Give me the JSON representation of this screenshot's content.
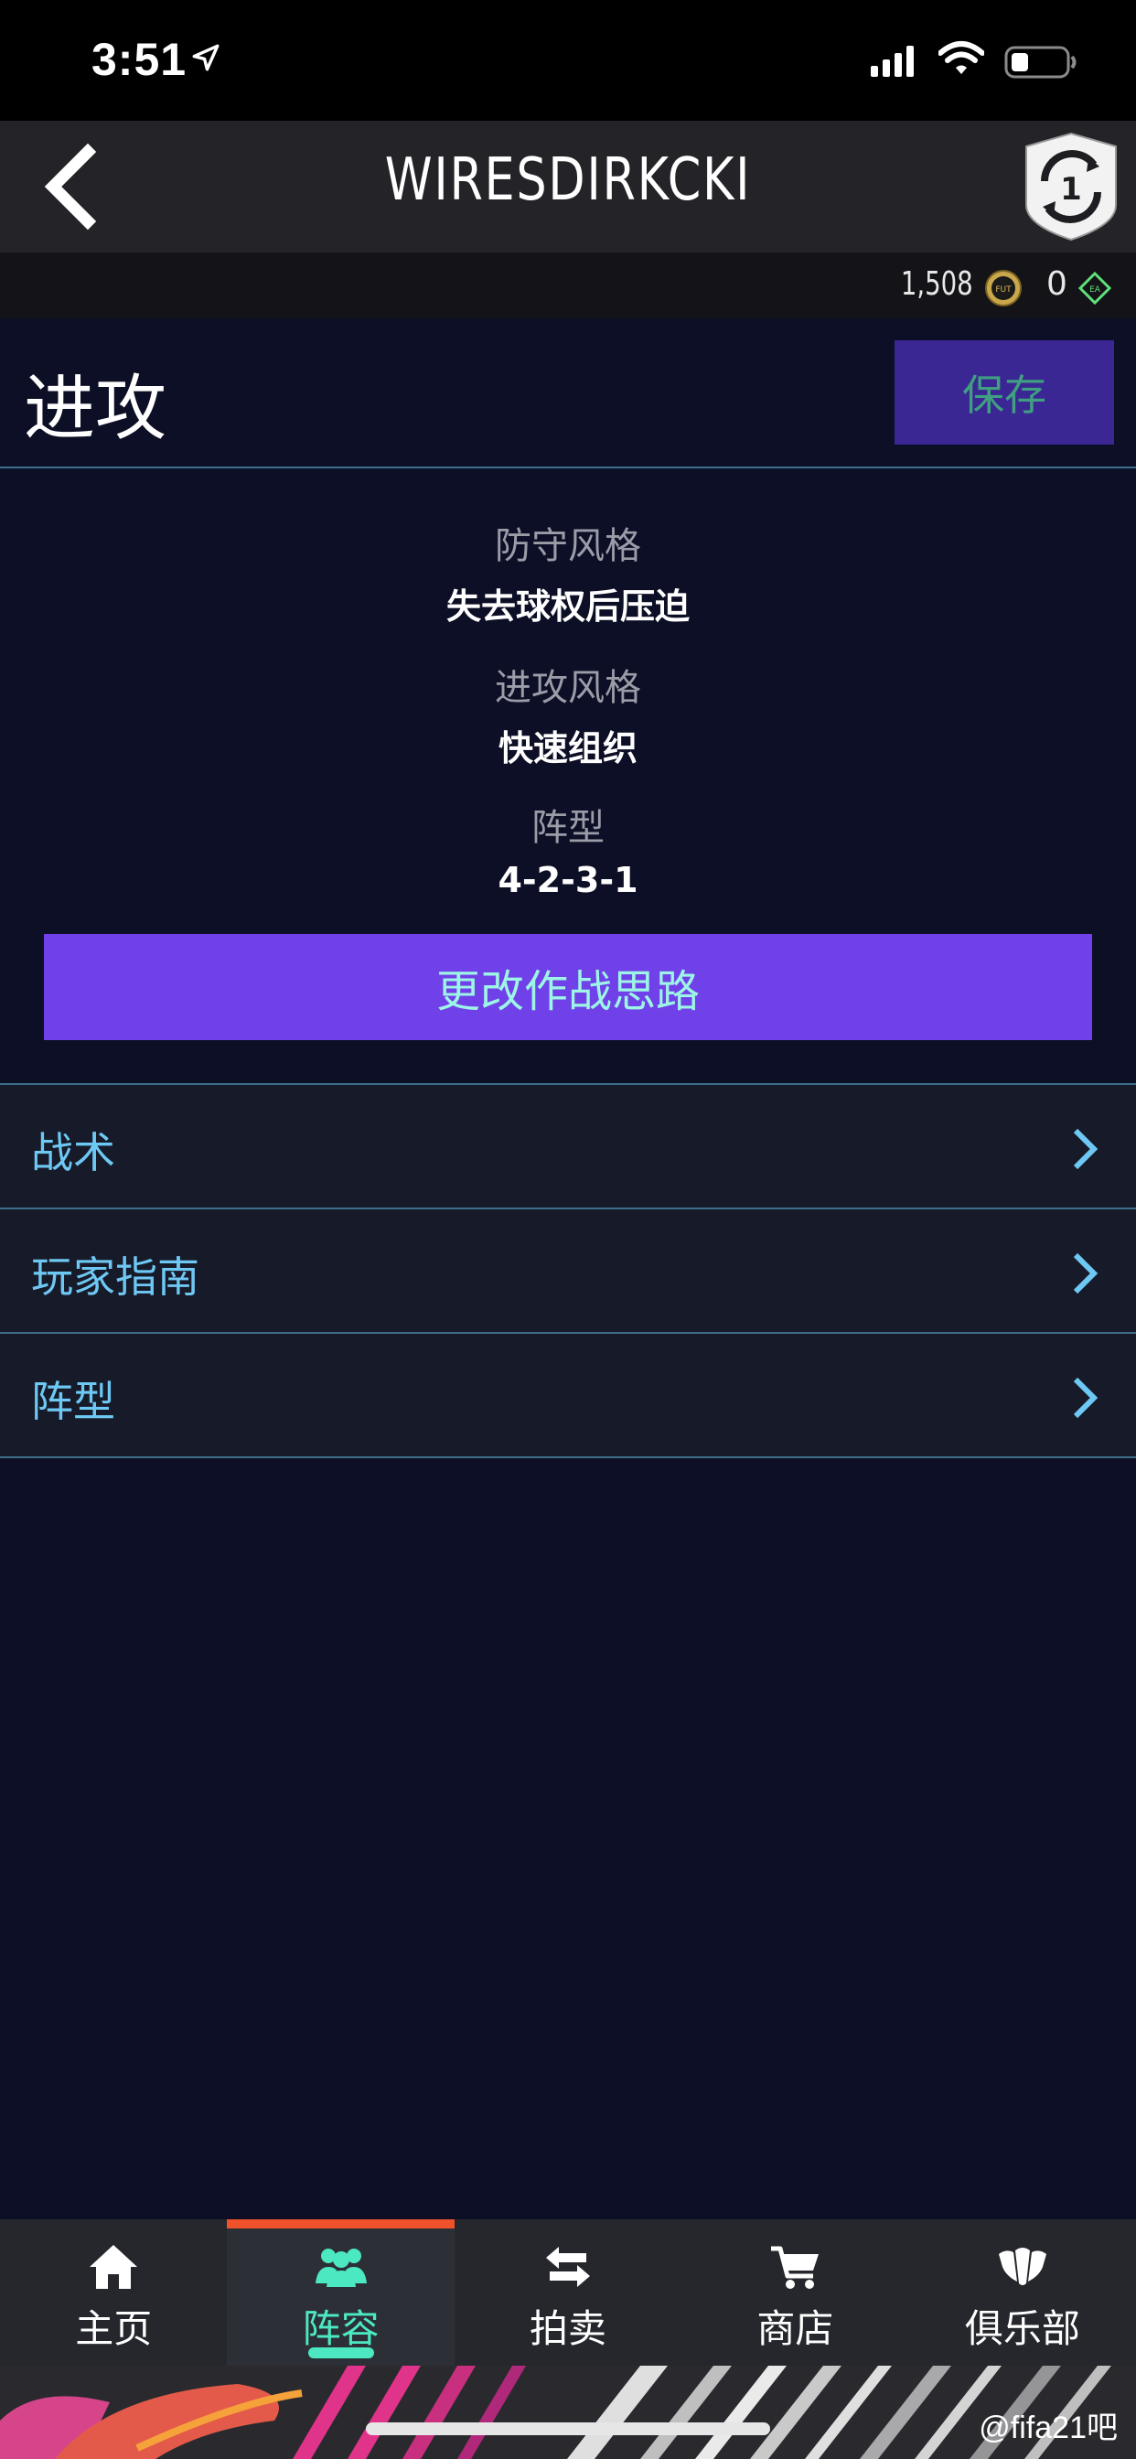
{
  "status_bar": {
    "time": "3:51"
  },
  "nav": {
    "title": "WIRESDIRKCKI",
    "badge_number": "1"
  },
  "currency": {
    "coins": "1,508",
    "coin_label": "FUT",
    "points": "0",
    "points_label": "EA"
  },
  "header": {
    "title": "进攻",
    "save_label": "保存"
  },
  "summary": {
    "items": [
      {
        "label": "防守风格",
        "value": "失去球权后压迫"
      },
      {
        "label": "进攻风格",
        "value": "快速组织"
      },
      {
        "label": "阵型",
        "value": "4-2-3-1"
      }
    ],
    "change_button_label": "更改作战思路"
  },
  "menu": {
    "items": [
      {
        "label": "战术"
      },
      {
        "label": "玩家指南"
      },
      {
        "label": "阵型"
      }
    ]
  },
  "tab_bar": {
    "tabs": [
      {
        "label": "主页",
        "icon": "home-icon"
      },
      {
        "label": "阵容",
        "icon": "squad-icon",
        "active": true
      },
      {
        "label": "拍卖",
        "icon": "transfer-icon"
      },
      {
        "label": "商店",
        "icon": "cart-icon"
      },
      {
        "label": "俱乐部",
        "icon": "club-icon"
      }
    ]
  },
  "watermark": "@fifa21吧",
  "colors": {
    "background": "#0c0f25",
    "accent_purple": "#7041e8",
    "link_blue": "#6ec8f4",
    "active_tab_teal": "#4ce8c2",
    "active_tab_top_bar": "#f0522b",
    "divider": "#3e6f8a"
  }
}
